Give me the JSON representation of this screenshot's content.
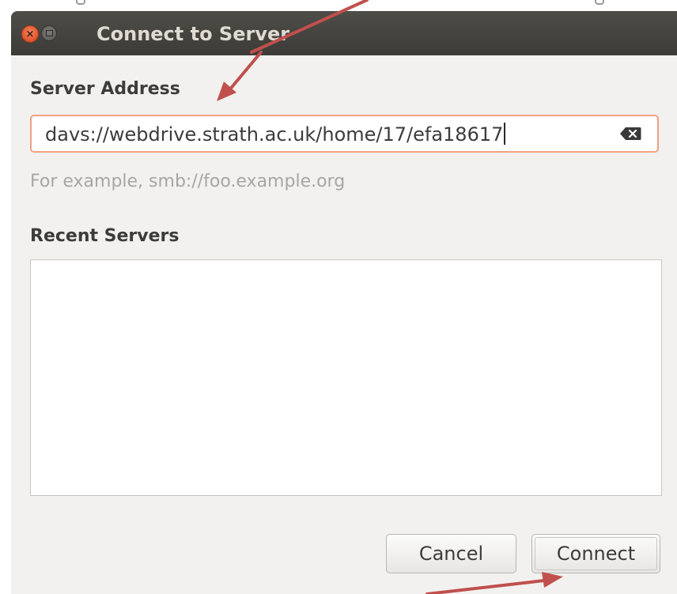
{
  "window": {
    "title": "Connect to Server"
  },
  "server_address": {
    "label": "Server Address",
    "value": "davs://webdrive.strath.ac.uk/home/17/efa18617",
    "hint": "For example, smb://foo.example.org"
  },
  "recent_servers": {
    "label": "Recent Servers",
    "items": []
  },
  "buttons": {
    "cancel": "Cancel",
    "connect": "Connect"
  },
  "icons": {
    "close": "close-icon",
    "maximize": "maximize-icon",
    "clear": "clear-text-icon"
  },
  "colors": {
    "titlebar": "#3c3b37",
    "close_button": "#e0532a",
    "input_focus_border": "#f0a184",
    "annotation_arrow": "#c0504d"
  }
}
